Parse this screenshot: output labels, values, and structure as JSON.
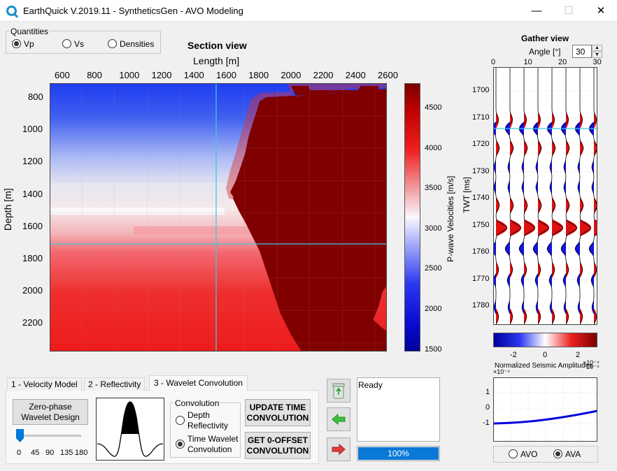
{
  "window": {
    "title": "EarthQuick V.2019.11 - SyntheticsGen - AVO Modeling",
    "minimize_icon": "—",
    "maximize_icon": "☐",
    "close_icon": "✕"
  },
  "quantities": {
    "title": "Quantities",
    "options": [
      "Vp",
      "Vs",
      "Densities"
    ],
    "selected": "Vp"
  },
  "section_view": {
    "title": "Section view",
    "xlabel": "Length [m]",
    "ylabel": "Depth [m]",
    "xticks": [
      "600",
      "800",
      "1000",
      "1200",
      "1400",
      "1600",
      "1800",
      "2000",
      "2200",
      "2400",
      "2600"
    ],
    "yticks": [
      "800",
      "1000",
      "1200",
      "1400",
      "1600",
      "1800",
      "2000",
      "2200"
    ],
    "colorbar_label": "P-wave Velocities [m/s]",
    "colorbar_ticks": [
      "4500",
      "4000",
      "3500",
      "3000",
      "2500",
      "2000",
      "1500"
    ]
  },
  "gather_view": {
    "title": "Gather view",
    "angle_label": "Angle [°]",
    "angle_value": "30",
    "xticks": [
      "0",
      "10",
      "20",
      "30"
    ],
    "ylabel": "TWT [ms]",
    "yticks": [
      "1700",
      "1710",
      "1720",
      "1730",
      "1740",
      "1750",
      "1760",
      "1770",
      "1780"
    ],
    "colorbar_ticks": [
      "-2",
      "0",
      "2"
    ],
    "colorbar_exponent": "×10⁻⁴",
    "colorbar_label": "Normalized Seismic Amplitudes"
  },
  "avo_plot": {
    "yexponent": "×10⁻⁴",
    "yticks": [
      "1",
      "0",
      "-1"
    ],
    "xexponent": "10⁻⁴"
  },
  "avo_mode": {
    "options": [
      "AVO",
      "AVA"
    ],
    "selected": "AVA"
  },
  "tabs": {
    "items": [
      "1 - Velocity Model",
      "2 - Reflectivity",
      "3 - Wavelet Convolution"
    ],
    "active": "3 - Wavelet Convolution"
  },
  "wavelet": {
    "design_button": "Zero-phase\nWavelet Design",
    "slider_ticks": [
      "0",
      "45",
      "90",
      "135",
      "180"
    ],
    "phase_value": 0
  },
  "convolution": {
    "title": "Convolution",
    "options": [
      "Depth\nReflectivity",
      "Time Wavelet\nConvolution"
    ],
    "selected": "Time Wavelet\nConvolution",
    "update_button": "UPDATE TIME\nCONVOLUTION",
    "zero_offset_button": "GET 0-OFFSET\nCONVOLUTION"
  },
  "status": {
    "text": "Ready",
    "progress_text": "100%",
    "progress": 1.0
  }
}
